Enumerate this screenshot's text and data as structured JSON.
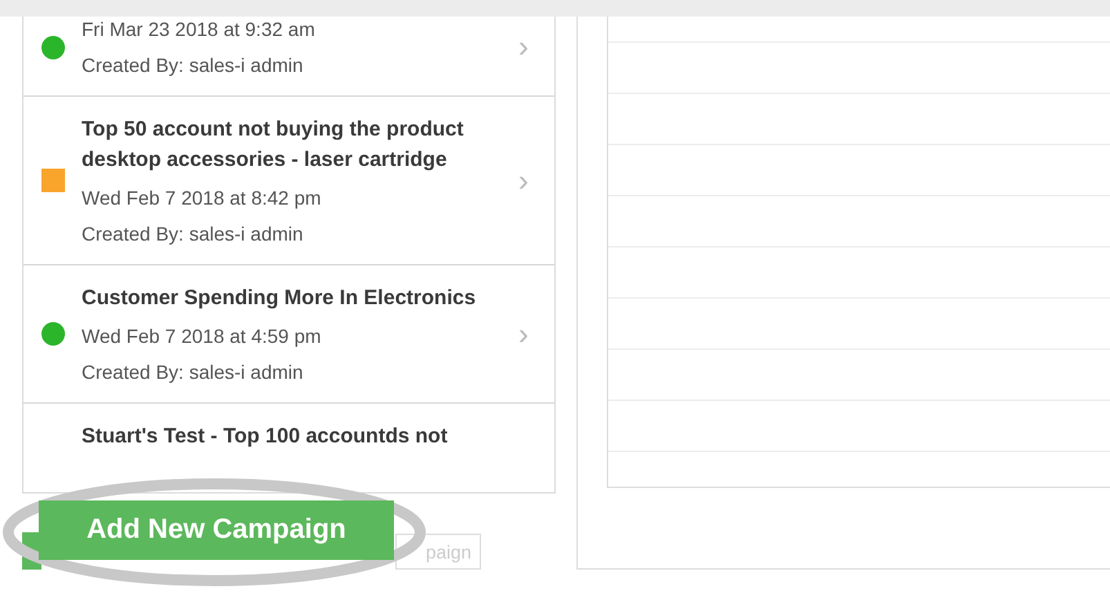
{
  "campaigns": [
    {
      "date": "Fri Mar 23 2018 at 9:32 am",
      "created_by": "Created By: sales-i admin",
      "marker": {
        "kind": "circle",
        "color": "#2bb52b"
      }
    },
    {
      "title": "Top 50 account not buying the product desktop accessories - laser cartridge",
      "date": "Wed Feb 7 2018 at 8:42 pm",
      "created_by": "Created By: sales-i admin",
      "marker": {
        "kind": "square",
        "color": "#f9a42b"
      }
    },
    {
      "title": "Customer Spending More In Electronics",
      "date": "Wed Feb 7 2018 at 4:59 pm",
      "created_by": "Created By: sales-i admin",
      "marker": {
        "kind": "circle",
        "color": "#2bb52b"
      }
    },
    {
      "title": "Stuart's Test - Top 100 accountds not"
    }
  ],
  "chevron": "›",
  "add_button": "Add New Campaign",
  "hidden_button": "paign"
}
